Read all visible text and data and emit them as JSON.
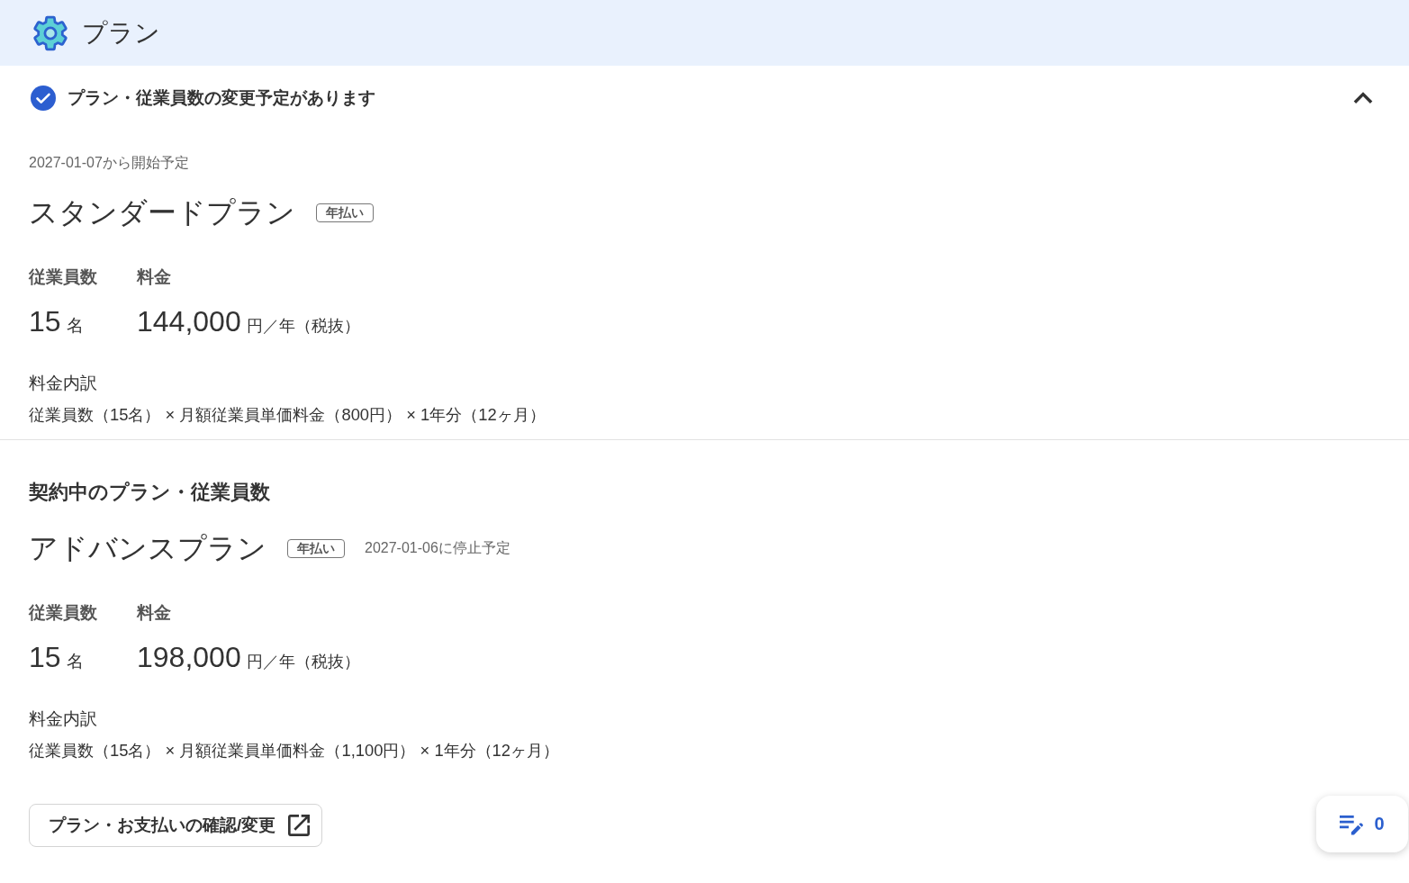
{
  "header": {
    "title": "プラン"
  },
  "notice": {
    "title": "プラン・従業員数の変更予定があります",
    "expanded": true
  },
  "scheduled_plan": {
    "start_note": "2027-01-07から開始予定",
    "name": "スタンダードプラン",
    "billing_tag": "年払い",
    "employees_label": "従業員数",
    "fee_label": "料金",
    "employees_value": "15",
    "employees_unit": "名",
    "fee_value": "144,000",
    "fee_unit": "円／年（税抜）",
    "breakdown_label": "料金内訳",
    "breakdown": "従業員数（15名） × 月額従業員単価料金（800円） × 1年分（12ヶ月）"
  },
  "current_plan": {
    "heading": "契約中のプラン・従業員数",
    "name": "アドバンスプラン",
    "billing_tag": "年払い",
    "stop_note": "2027-01-06に停止予定",
    "employees_label": "従業員数",
    "fee_label": "料金",
    "employees_value": "15",
    "employees_unit": "名",
    "fee_value": "198,000",
    "fee_unit": "円／年（税抜）",
    "breakdown_label": "料金内訳",
    "breakdown": "従業員数（15名） × 月額従業員単価料金（1,100円） × 1年分（12ヶ月）"
  },
  "manage_button": {
    "label": "プラン・お支払いの確認/変更"
  },
  "memo_button": {
    "count": "0"
  }
}
